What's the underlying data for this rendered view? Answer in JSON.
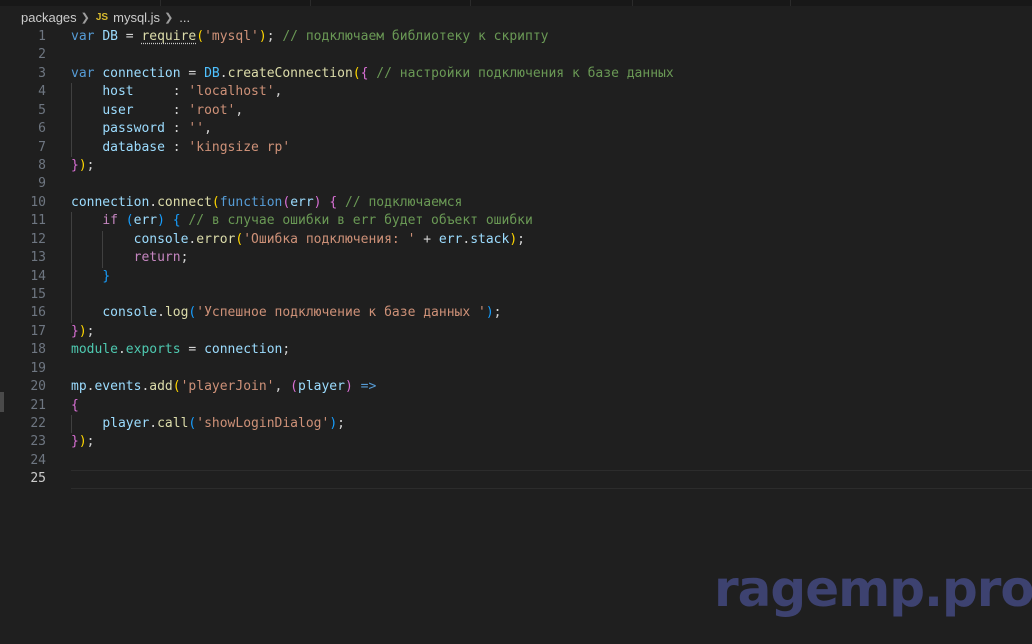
{
  "breadcrumb": {
    "folder": "packages",
    "file_badge": "JS",
    "file": "mysql.js",
    "more": "..."
  },
  "editor": {
    "active_line": 25,
    "lines": [
      [
        [
          "kw",
          "var "
        ],
        [
          "var",
          "DB"
        ],
        [
          "pun",
          " = "
        ],
        [
          "fn sq",
          "require"
        ],
        [
          "br1",
          "("
        ],
        [
          "str",
          "'mysql'"
        ],
        [
          "br1",
          ")"
        ],
        [
          "pun",
          "; "
        ],
        [
          "cm",
          "// подключаем библиотеку к скрипту"
        ]
      ],
      [],
      [
        [
          "kw",
          "var "
        ],
        [
          "var",
          "connection"
        ],
        [
          "pun",
          " = "
        ],
        [
          "con",
          "DB"
        ],
        [
          "pun",
          "."
        ],
        [
          "fn",
          "createConnection"
        ],
        [
          "br1",
          "("
        ],
        [
          "br2",
          "{"
        ],
        [
          "pun",
          " "
        ],
        [
          "cm",
          "// настройки подключения к базе данных"
        ]
      ],
      [
        [
          "pun",
          "    "
        ],
        [
          "var",
          "host"
        ],
        [
          "pun",
          "     : "
        ],
        [
          "str",
          "'localhost'"
        ],
        [
          "pun",
          ","
        ]
      ],
      [
        [
          "pun",
          "    "
        ],
        [
          "var",
          "user"
        ],
        [
          "pun",
          "     : "
        ],
        [
          "str",
          "'root'"
        ],
        [
          "pun",
          ","
        ]
      ],
      [
        [
          "pun",
          "    "
        ],
        [
          "var",
          "password"
        ],
        [
          "pun",
          " : "
        ],
        [
          "str",
          "''"
        ],
        [
          "pun",
          ","
        ]
      ],
      [
        [
          "pun",
          "    "
        ],
        [
          "var",
          "database"
        ],
        [
          "pun",
          " : "
        ],
        [
          "str",
          "'kingsize rp'"
        ]
      ],
      [
        [
          "br2",
          "}"
        ],
        [
          "br1",
          ")"
        ],
        [
          "pun",
          ";"
        ]
      ],
      [],
      [
        [
          "var",
          "connection"
        ],
        [
          "pun",
          "."
        ],
        [
          "fn",
          "connect"
        ],
        [
          "br1",
          "("
        ],
        [
          "kw",
          "function"
        ],
        [
          "br2",
          "("
        ],
        [
          "var",
          "err"
        ],
        [
          "br2",
          ")"
        ],
        [
          "pun",
          " "
        ],
        [
          "br2",
          "{"
        ],
        [
          "pun",
          " "
        ],
        [
          "cm",
          "// подключаемся"
        ]
      ],
      [
        [
          "pun",
          "    "
        ],
        [
          "cf",
          "if"
        ],
        [
          "pun",
          " "
        ],
        [
          "br3",
          "("
        ],
        [
          "var",
          "err"
        ],
        [
          "br3",
          ")"
        ],
        [
          "pun",
          " "
        ],
        [
          "br3",
          "{"
        ],
        [
          "pun",
          " "
        ],
        [
          "cm",
          "// в случае ошибки в err будет объект ошибки"
        ]
      ],
      [
        [
          "pun",
          "        "
        ],
        [
          "var",
          "console"
        ],
        [
          "pun",
          "."
        ],
        [
          "fn",
          "error"
        ],
        [
          "br1",
          "("
        ],
        [
          "str",
          "'Ошибка подключения: '"
        ],
        [
          "pun",
          " + "
        ],
        [
          "var",
          "err"
        ],
        [
          "pun",
          "."
        ],
        [
          "var",
          "stack"
        ],
        [
          "br1",
          ")"
        ],
        [
          "pun",
          ";"
        ]
      ],
      [
        [
          "pun",
          "        "
        ],
        [
          "cf",
          "return"
        ],
        [
          "pun",
          ";"
        ]
      ],
      [
        [
          "pun",
          "    "
        ],
        [
          "br3",
          "}"
        ]
      ],
      [],
      [
        [
          "pun",
          "    "
        ],
        [
          "var",
          "console"
        ],
        [
          "pun",
          "."
        ],
        [
          "fn",
          "log"
        ],
        [
          "br3",
          "("
        ],
        [
          "str",
          "'Успешное подключение к базе данных '"
        ],
        [
          "br3",
          ")"
        ],
        [
          "pun",
          ";"
        ]
      ],
      [
        [
          "br2",
          "}"
        ],
        [
          "br1",
          ")"
        ],
        [
          "pun",
          ";"
        ]
      ],
      [
        [
          "cls",
          "module"
        ],
        [
          "pun",
          "."
        ],
        [
          "cls",
          "exports"
        ],
        [
          "pun",
          " = "
        ],
        [
          "var",
          "connection"
        ],
        [
          "pun",
          ";"
        ]
      ],
      [],
      [
        [
          "var",
          "mp"
        ],
        [
          "pun",
          "."
        ],
        [
          "var",
          "events"
        ],
        [
          "pun",
          "."
        ],
        [
          "fn",
          "add"
        ],
        [
          "br1",
          "("
        ],
        [
          "str",
          "'playerJoin'"
        ],
        [
          "pun",
          ", "
        ],
        [
          "br2",
          "("
        ],
        [
          "var",
          "player"
        ],
        [
          "br2",
          ")"
        ],
        [
          "pun",
          " "
        ],
        [
          "kw",
          "=>"
        ]
      ],
      [
        [
          "br2",
          "{"
        ]
      ],
      [
        [
          "pun",
          "    "
        ],
        [
          "var",
          "player"
        ],
        [
          "pun",
          "."
        ],
        [
          "fn",
          "call"
        ],
        [
          "br3",
          "("
        ],
        [
          "str",
          "'showLoginDialog'"
        ],
        [
          "br3",
          ")"
        ],
        [
          "pun",
          ";"
        ]
      ],
      [
        [
          "br2",
          "}"
        ],
        [
          "br1",
          ")"
        ],
        [
          "pun",
          ";"
        ]
      ],
      [],
      []
    ]
  },
  "watermark": "ragemp.pro"
}
